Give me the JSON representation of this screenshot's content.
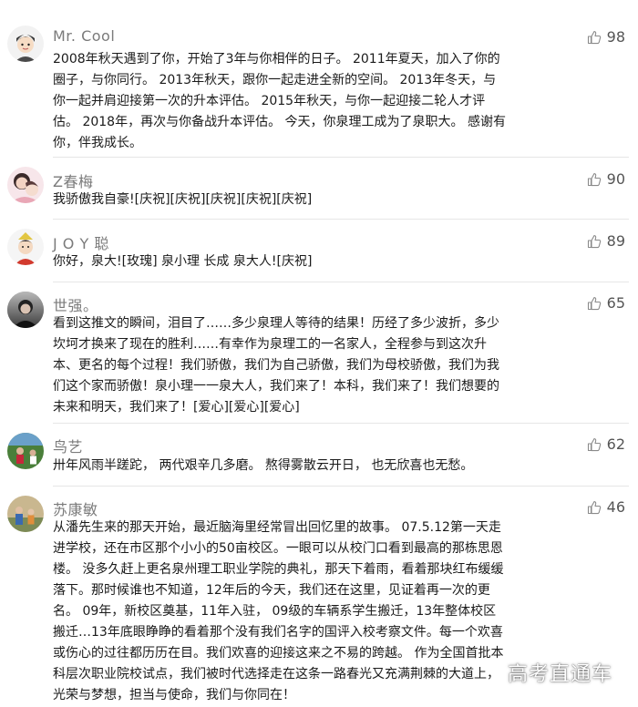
{
  "icons": {
    "like": "thumbs-up-icon"
  },
  "comments": [
    {
      "name": "Mr. Cool",
      "likes": "98",
      "avatar": "avatar-cartoon-boy",
      "text": "2008年秋天遇到了你，开始了3年与你相伴的日子。 2011年夏天，加入了你的圈子，与你同行。 2013年秋天，跟你一起走进全新的空间。 2013年冬天，与你一起并肩迎接第一次的升本评估。 2015年秋天，与你一起迎接二轮人才评估。 2018年，再次与你备战升本评估。 今天，你泉理工成为了泉职大。 感谢有你，伴我成长。"
    },
    {
      "name": "Z春梅",
      "likes": "90",
      "avatar": "avatar-mother-child",
      "text": "我骄傲我自豪![庆祝][庆祝][庆祝][庆祝][庆祝]"
    },
    {
      "name": "J O Y 聪",
      "likes": "89",
      "avatar": "avatar-cartoon-red",
      "text": "你好，泉大![玫瑰] 泉小理 长成 泉大人![庆祝]"
    },
    {
      "name": "世强。",
      "likes": "65",
      "avatar": "avatar-dark-person",
      "text": "看到这推文的瞬间，泪目了……多少泉理人等待的结果！历经了多少波折，多少坎坷才换来了现在的胜利……有幸作为泉理工的一名家人，全程参与到这次升本、更名的每个过程！我们骄傲，我们为自己骄傲，我们为母校骄傲，我们为我们这个家而骄傲！泉小理一一泉大人，我们来了！本科，我们来了！我们想要的未来和明天，我们来了！[爱心][爱心][爱心]"
    },
    {
      "name": "鸟艺",
      "likes": "62",
      "avatar": "avatar-sports-field",
      "text": "卅年风雨半蹉跎， 两代艰辛几多磨。 熬得雾散云开日， 也无欣喜也无愁。"
    },
    {
      "name": "苏康敏",
      "likes": "46",
      "avatar": "avatar-family-photo",
      "text": "从潘先生来的那天开始，最近脑海里经常冒出回忆里的故事。 07.5.12第一天走进学校，还在市区那个小小的50亩校区。一眼可以从校门口看到最高的那栋思恩楼。 没多久赶上更名泉州理工职业学院的典礼，那天下着雨，看着那块红布缓缓落下。那时候谁也不知道，12年后的今天，我们还在这里，见证着再一次的更名。 09年，新校区奠基，11年入驻， 09级的车辆系学生搬迁，13年整体校区搬迁…13年底眼睁睁的看着那个没有我们名字的国评入校考察文件。每一个欢喜或伤心的过往都历历在目。我们欢喜的迎接这来之不易的跨越。 作为全国首批本科层次职业院校试点，我们被时代选择走在这条一路春光又充满荆棘的大道上，光荣与梦想，担当与使命，我们与你同在！"
    }
  ],
  "watermark": "高考直通车"
}
